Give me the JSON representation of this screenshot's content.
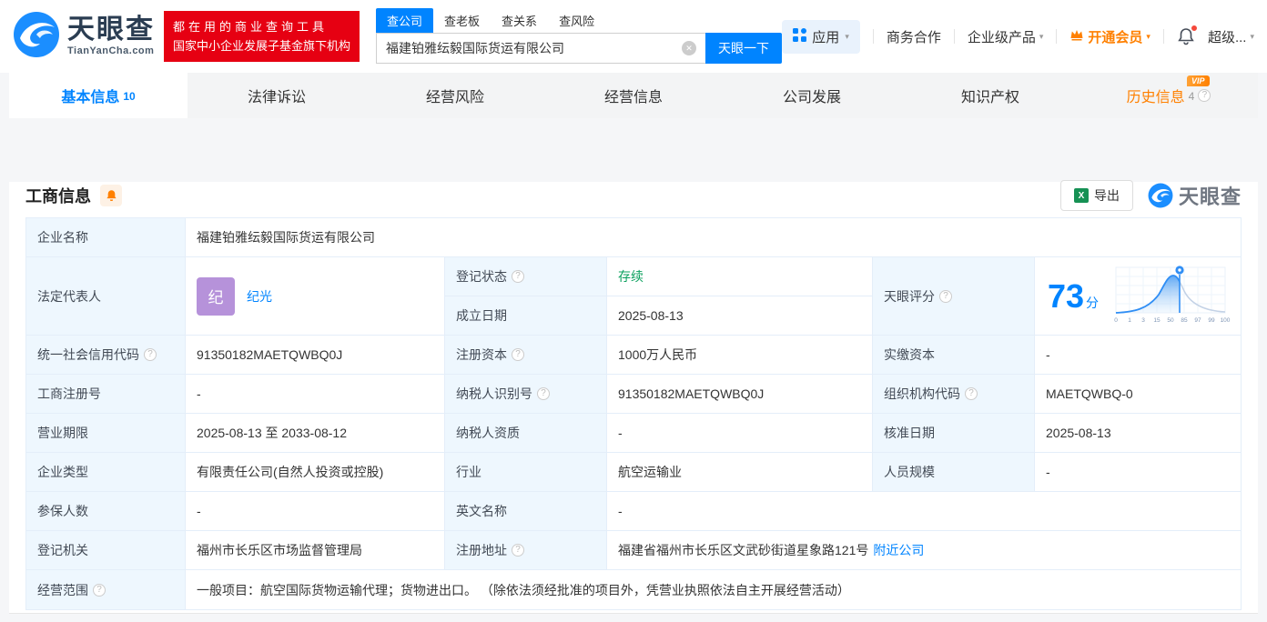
{
  "header": {
    "logo_title": "天眼查",
    "logo_domain": "TianYanCha.com",
    "promo_line1": "都在用的商业查询工具",
    "promo_line2": "国家中小企业发展子基金旗下机构",
    "search_tabs": [
      {
        "label": "查公司",
        "active": true
      },
      {
        "label": "查老板",
        "active": false
      },
      {
        "label": "查关系",
        "active": false
      },
      {
        "label": "查风险",
        "active": false
      }
    ],
    "search_value": "福建铂雅纭毅国际货运有限公司",
    "search_button": "天眼一下",
    "nav_apps": "应用",
    "nav_coop": "商务合作",
    "nav_enterprise": "企业级产品",
    "nav_vip": "开通会员",
    "nav_user": "超级..."
  },
  "page_tabs": [
    {
      "label": "基本信息",
      "count": "10",
      "active": true
    },
    {
      "label": "法律诉讼"
    },
    {
      "label": "经营风险"
    },
    {
      "label": "经营信息"
    },
    {
      "label": "公司发展"
    },
    {
      "label": "知识产权"
    },
    {
      "label": "历史信息",
      "count": "4",
      "vip": true
    }
  ],
  "section": {
    "title": "工商信息",
    "export_label": "导出",
    "brand": "天眼查"
  },
  "info": {
    "company_name": {
      "label": "企业名称",
      "value": "福建铂雅纭毅国际货运有限公司"
    },
    "legal_rep": {
      "label": "法定代表人",
      "avatar": "纪",
      "name": "纪光"
    },
    "reg_status": {
      "label": "登记状态",
      "value": "存续"
    },
    "establish_date": {
      "label": "成立日期",
      "value": "2025-08-13"
    },
    "score_label": "天眼评分",
    "credit_code": {
      "label": "统一社会信用代码",
      "value": "91350182MAETQWBQ0J"
    },
    "reg_capital": {
      "label": "注册资本",
      "value": "1000万人民币"
    },
    "paid_capital": {
      "label": "实缴资本",
      "value": "-"
    },
    "reg_number": {
      "label": "工商注册号",
      "value": "-"
    },
    "taxpayer_id": {
      "label": "纳税人识别号",
      "value": "91350182MAETQWBQ0J"
    },
    "org_code": {
      "label": "组织机构代码",
      "value": "MAETQWBQ-0"
    },
    "business_term": {
      "label": "营业期限",
      "value": "2025-08-13 至 2033-08-12"
    },
    "taxpayer_qualification": {
      "label": "纳税人资质",
      "value": "-"
    },
    "approval_date": {
      "label": "核准日期",
      "value": "2025-08-13"
    },
    "company_type": {
      "label": "企业类型",
      "value": "有限责任公司(自然人投资或控股)"
    },
    "industry": {
      "label": "行业",
      "value": "航空运输业"
    },
    "staff_size": {
      "label": "人员规模",
      "value": "-"
    },
    "insured_count": {
      "label": "参保人数",
      "value": "-"
    },
    "english_name": {
      "label": "英文名称",
      "value": "-"
    },
    "reg_authority": {
      "label": "登记机关",
      "value": "福州市长乐区市场监督管理局"
    },
    "reg_address": {
      "label": "注册地址",
      "value": "福建省福州市长乐区文武砂街道星象路121号",
      "link": "附近公司"
    },
    "business_scope": {
      "label": "经营范围",
      "value": "一般项目：航空国际货物运输代理；货物进出口。 （除依法须经批准的项目外，凭营业执照依法自主开展经营活动）"
    }
  },
  "score": {
    "value": "73",
    "unit": "分"
  },
  "chart_data": {
    "type": "area",
    "title": "天眼评分分布",
    "score": 73,
    "x_ticks": [
      "0",
      "1",
      "3",
      "15",
      "50",
      "85",
      "97",
      "99",
      "100"
    ],
    "marker_x": 73,
    "legend_position": "none",
    "grid": true
  },
  "colors": {
    "accent": "#0084ff",
    "status_green": "#0ba05e",
    "vip_orange": "#ff8000",
    "promo_red": "#e60012",
    "avatar_purple": "#b692da",
    "label_bg": "#eef7fe"
  },
  "glyphs": {
    "caret": "▾",
    "help": "?",
    "clear": "✕",
    "vip": "VIP",
    "excel": "X"
  }
}
